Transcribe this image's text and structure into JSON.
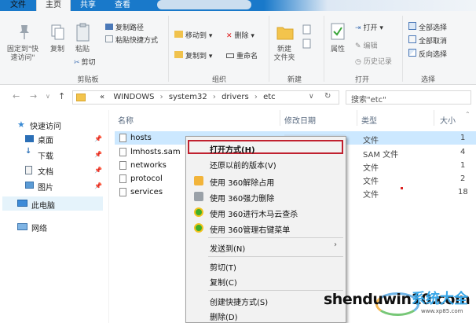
{
  "ribbon_tabs": [
    "文件",
    "主页",
    "共享",
    "查看"
  ],
  "clipboard": {
    "pin_quick": "固定到\"快\n速访问\"",
    "copy": "复制",
    "paste": "粘贴",
    "copy_path": "复制路径",
    "paste_shortcut": "粘贴快捷方式",
    "cut": "剪切",
    "label": "剪贴板"
  },
  "organize": {
    "move_to": "移动到 ▾",
    "delete": "删除 ▾",
    "copy_to": "复制到 ▾",
    "rename": "重命名",
    "label": "组织"
  },
  "new_group": {
    "new_folder": "新建\n文件夹",
    "label": "新建"
  },
  "open_group": {
    "properties": "属性",
    "open": "打开 ▾",
    "edit": "编辑",
    "history": "历史记录",
    "label": "打开"
  },
  "select_group": {
    "select_all": "全部选择",
    "select_none": "全部取消",
    "invert": "反向选择",
    "label": "选择"
  },
  "address": {
    "path": [
      "«",
      "WINDOWS",
      "›",
      "system32",
      "›",
      "drivers",
      "›",
      "etc"
    ],
    "search_placeholder": "搜索\"etc\""
  },
  "nav": {
    "quick_access": "快速访问",
    "desktop": "桌面",
    "downloads": "下载",
    "documents": "文档",
    "pictures": "图片",
    "this_pc": "此电脑",
    "network": "网络"
  },
  "columns": {
    "name": "名称",
    "date": "修改日期",
    "type": "类型",
    "size": "大小"
  },
  "files": [
    {
      "name": "hosts",
      "type": "文件",
      "size": "1"
    },
    {
      "name": "lmhosts.sam",
      "type": "SAM 文件",
      "size": "4"
    },
    {
      "name": "networks",
      "type": "文件",
      "size": "1"
    },
    {
      "name": "protocol",
      "type": "文件",
      "size": "2"
    },
    {
      "name": "services",
      "type": "文件",
      "size": "18"
    }
  ],
  "context_menu": {
    "open_with": "打开方式(H)",
    "restore": "还原以前的版本(V)",
    "unlock_360": "使用 360解除占用",
    "force_delete_360": "使用 360强力删除",
    "scan_360": "使用 360进行木马云查杀",
    "manage_360": "使用 360管理右键菜单",
    "send_to": "发送到(N)",
    "cut": "剪切(T)",
    "copy": "复制(C)",
    "create_shortcut": "创建快捷方式(S)",
    "delete": "删除(D)"
  },
  "logo": {
    "text": "shenduwin10.com",
    "cn": "系统大全",
    "sub": "www.xp85.com"
  },
  "colors": {
    "accent": "#1979ca",
    "highlight_border": "#c0212f",
    "selection": "#cce8ff"
  }
}
